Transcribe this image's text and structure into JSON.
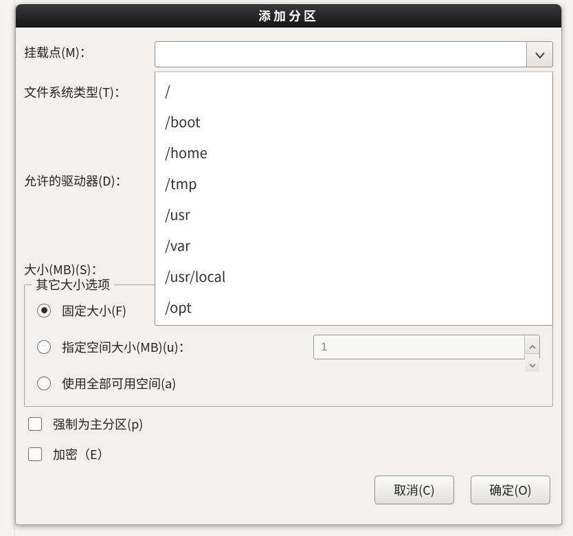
{
  "window": {
    "title": "添加分区"
  },
  "labels": {
    "mount_point": "挂载点(M)：",
    "fs_type": "文件系统类型(T)：",
    "allowed_drives": "允许的驱动器(D)：",
    "size_mb": "大小(MB)(S)："
  },
  "mount_point": {
    "value": "",
    "options": [
      "/",
      "/boot",
      "/home",
      "/tmp",
      "/usr",
      "/var",
      "/usr/local",
      "/opt"
    ]
  },
  "size_options": {
    "legend": "其它大小选项",
    "fixed": "固定大小(F)",
    "specify": "指定空间大小(MB)(u)：",
    "use_all": "使用全部可用空间(a)",
    "specify_value": "1",
    "selected": "fixed"
  },
  "checkboxes": {
    "force_primary": "强制为主分区(p)",
    "encrypt": "加密（E）"
  },
  "buttons": {
    "cancel": "取消(C)",
    "ok": "确定(O)"
  }
}
